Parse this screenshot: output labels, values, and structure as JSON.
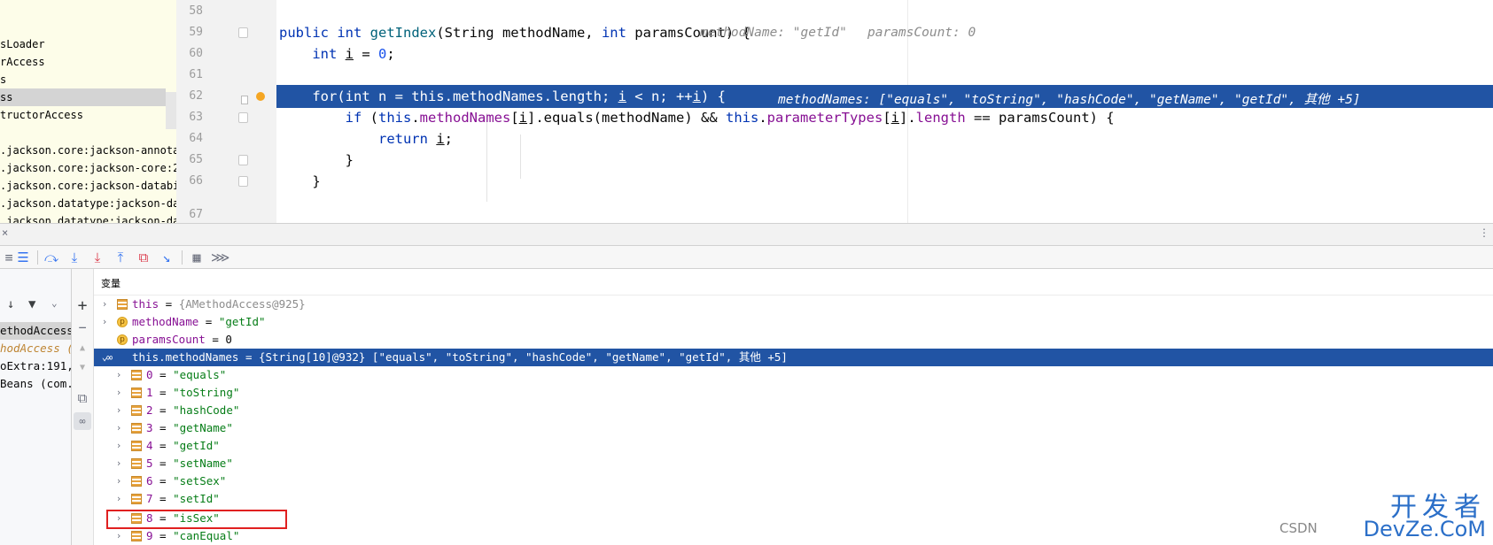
{
  "project_tree": {
    "items": [
      "sLoader",
      "rAccess",
      "s",
      "ss",
      "tructorAccess",
      ".jackson.core:jackson-annotat",
      ".jackson.core:jackson-core:2",
      ".jackson.core:jackson-databir",
      ".jackson.datatype:jackson-dat",
      ".jackson.datatype:jackson-dat"
    ]
  },
  "editor": {
    "lines": [
      {
        "num": "58"
      },
      {
        "num": "59",
        "hint_method_name": "methodName: \"getId\"",
        "hint_params_count": "paramsCount: 0"
      },
      {
        "num": "60"
      },
      {
        "num": "61"
      },
      {
        "num": "62",
        "hint": "methodNames: [\"equals\", \"toString\", \"hashCode\", \"getName\", \"getId\", 其他 +5]"
      },
      {
        "num": "63"
      },
      {
        "num": "64"
      },
      {
        "num": "65"
      },
      {
        "num": "66"
      },
      {
        "num": "67"
      }
    ]
  },
  "toolbar": {
    "icons": [
      "rerun-icon",
      "list-icon",
      "step-over-icon",
      "step-into-icon",
      "force-step-into-icon",
      "step-out-icon",
      "drop-frame-icon",
      "run-to-cursor-icon",
      "evaluate-icon",
      "trace-icon"
    ]
  },
  "frames": {
    "items": [
      "ethodAccess",
      "hodAccess (c",
      "oExtra:191,",
      "Beans (com.z"
    ]
  },
  "variables": {
    "title": "变量",
    "rows": [
      {
        "name": "this",
        "value": "{AMethodAccess@925}"
      },
      {
        "name": "methodName",
        "value": "\"getId\""
      },
      {
        "name": "paramsCount",
        "value": "0"
      },
      {
        "name": "this.methodNames",
        "value": "{String[10]@932} [\"equals\", \"toString\", \"hashCode\", \"getName\", \"getId\", 其他 +5]"
      },
      {
        "name": "0",
        "value": "\"equals\""
      },
      {
        "name": "1",
        "value": "\"toString\""
      },
      {
        "name": "2",
        "value": "\"hashCode\""
      },
      {
        "name": "3",
        "value": "\"getName\""
      },
      {
        "name": "4",
        "value": "\"getId\""
      },
      {
        "name": "5",
        "value": "\"setName\""
      },
      {
        "name": "6",
        "value": "\"setSex\""
      },
      {
        "name": "7",
        "value": "\"setId\""
      },
      {
        "name": "8",
        "value": "\"isSex\""
      },
      {
        "name": "9",
        "value": "\"canEqual\""
      }
    ]
  },
  "watermark": {
    "cn": "开发者",
    "en": "DevZe.CoM",
    "csdn": "CSDN"
  },
  "colors": {
    "highlight": "#2154a4",
    "keyword": "#0033b3",
    "string": "#067d17",
    "field": "#871094",
    "annotation_box": "#e02020"
  }
}
